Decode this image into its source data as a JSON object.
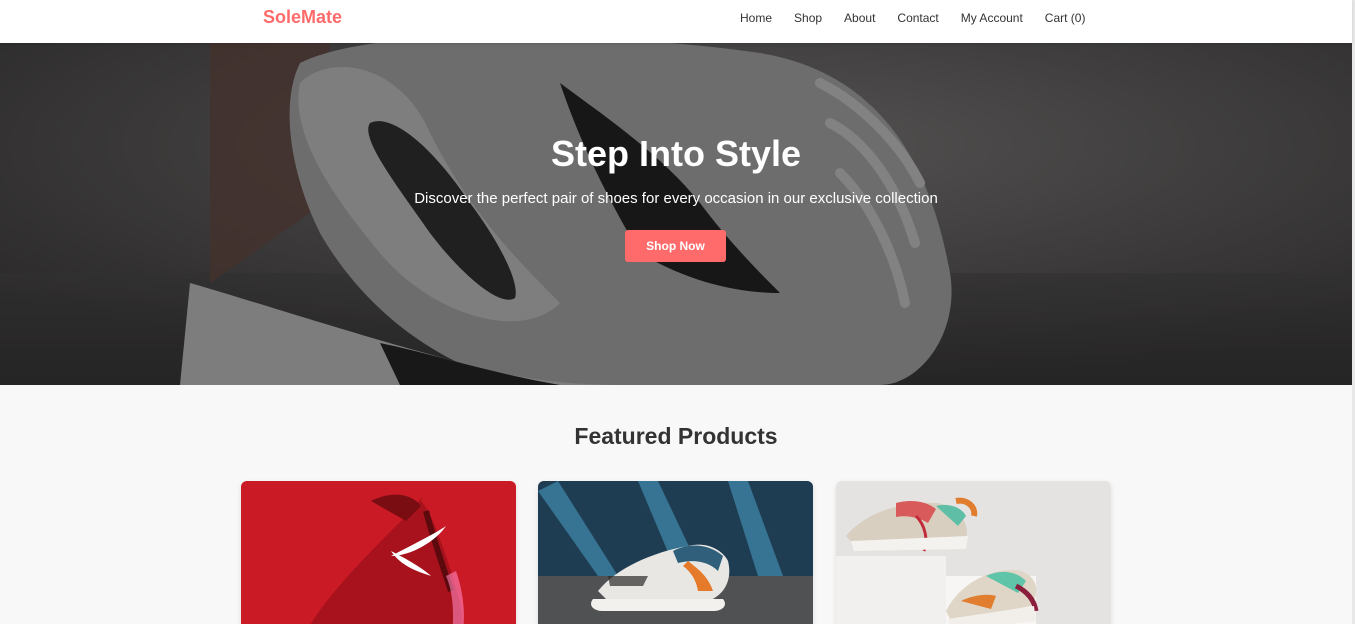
{
  "brand": {
    "name": "SoleMate",
    "color": "#ff6b6b"
  },
  "nav": {
    "items": [
      {
        "label": "Home"
      },
      {
        "label": "Shop"
      },
      {
        "label": "About"
      },
      {
        "label": "Contact"
      },
      {
        "label": "My Account"
      },
      {
        "label": "Cart (0)"
      }
    ]
  },
  "hero": {
    "title": "Step Into Style",
    "subtitle": "Discover the perfect pair of shoes for every occasion in our exclusive collection",
    "cta_label": "Shop Now",
    "image": "grey-nike-sneaker-photo"
  },
  "featured": {
    "title": "Featured Products",
    "products": [
      {
        "image": "red-nike-running-shoe-photo",
        "accent": "#d1202a"
      },
      {
        "image": "white-teal-orange-sneaker-on-street-photo",
        "accent": "#2f5f7a"
      },
      {
        "image": "colorful-chunky-sneakers-photo",
        "accent": "#e5e3e1"
      }
    ]
  }
}
